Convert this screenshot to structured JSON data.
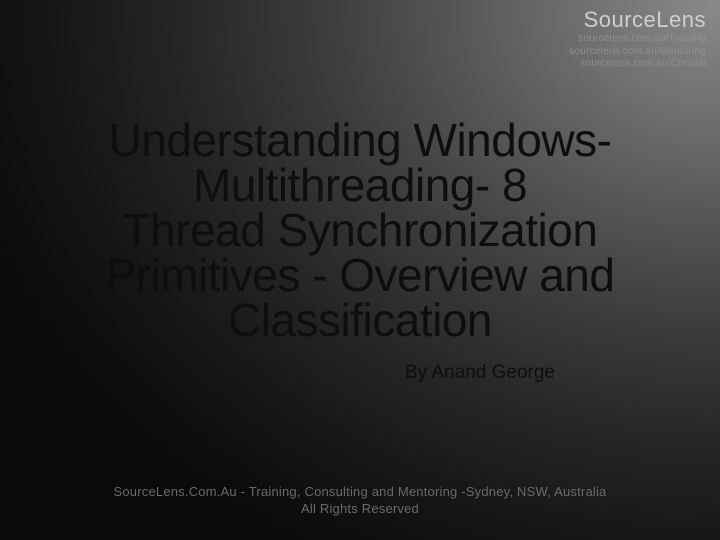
{
  "logo": {
    "brand_a": "Source",
    "brand_b": "Lens",
    "line1": "sourcelens.com.au/Training",
    "line2": "sourcelens.com.au/Mentoring",
    "line3": "sourcelens.com.au/Consult"
  },
  "title": {
    "line1": "Understanding Windows-",
    "line2": "Multithreading- 8",
    "line3": "Thread Synchronization",
    "line4": "Primitives - Overview and",
    "line5": "Classification"
  },
  "author": "By Anand George",
  "footer": {
    "line1": "SourceLens.Com.Au - Training, Consulting and Mentoring -Sydney, NSW, Australia",
    "line2": "All Rights Reserved"
  }
}
